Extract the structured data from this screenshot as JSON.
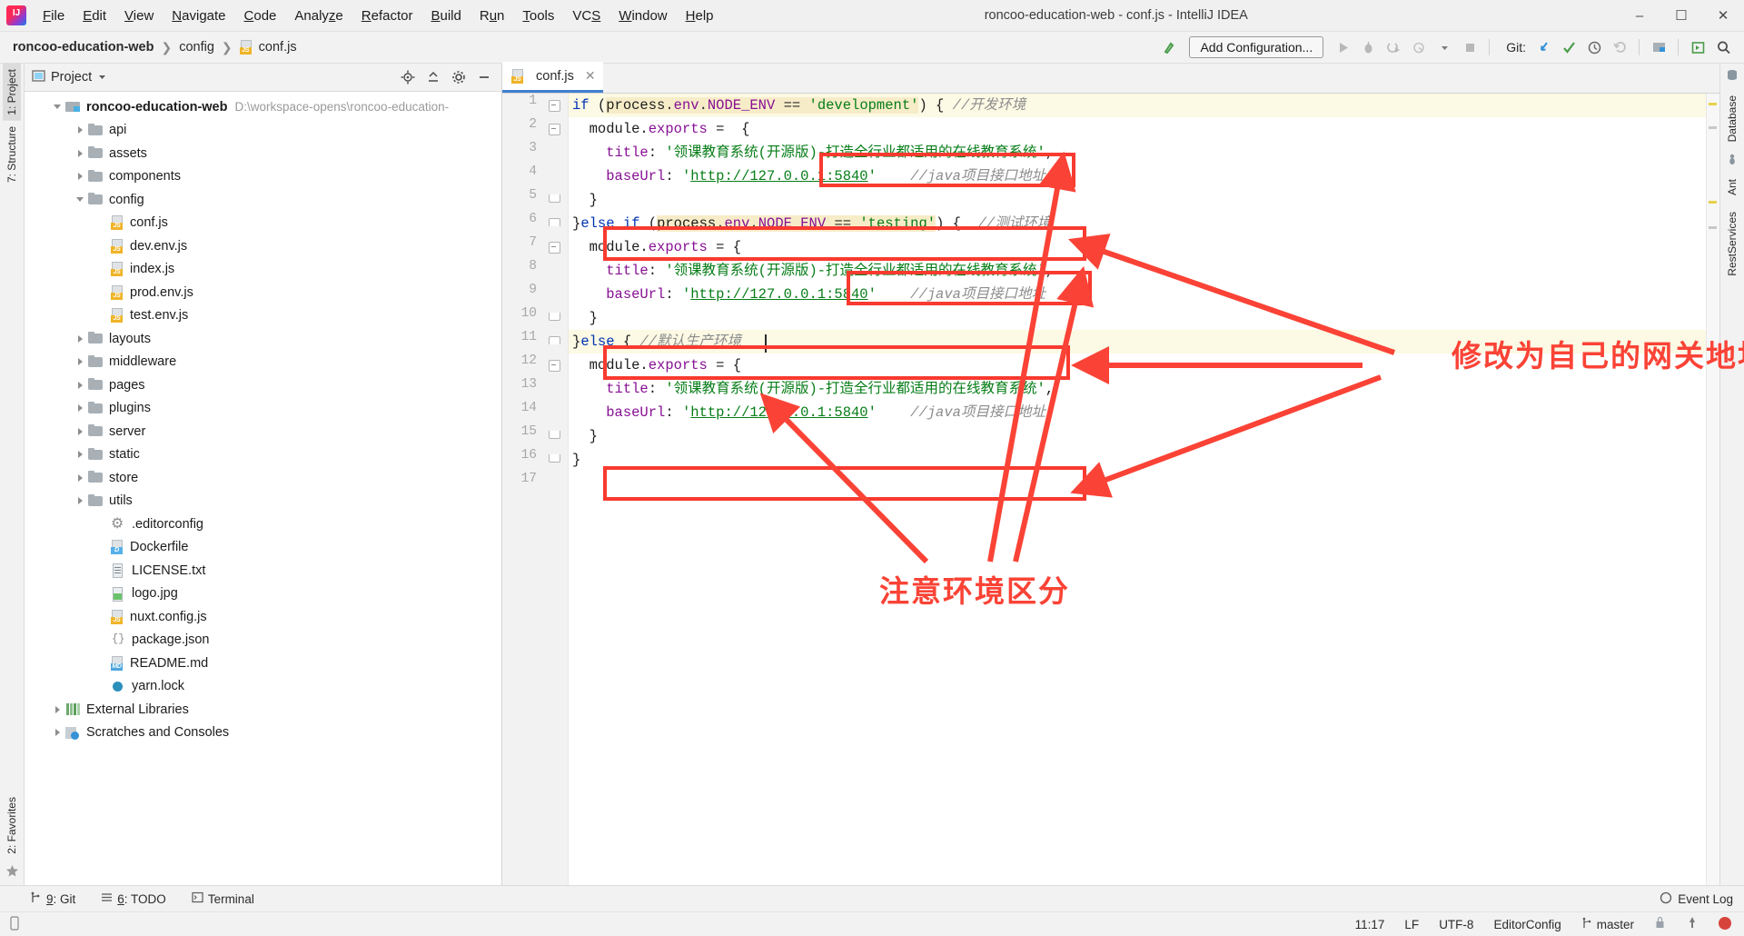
{
  "window": {
    "title": "roncoo-education-web - conf.js - IntelliJ IDEA",
    "logo_icon": "intellij-idea-logo",
    "minimize_icon": "minimize-icon",
    "maximize_icon": "maximize-icon",
    "close_icon": "close-icon"
  },
  "menubar": {
    "items": [
      {
        "label": "File"
      },
      {
        "label": "Edit"
      },
      {
        "label": "View"
      },
      {
        "label": "Navigate"
      },
      {
        "label": "Code"
      },
      {
        "label": "Analyze"
      },
      {
        "label": "Refactor"
      },
      {
        "label": "Build"
      },
      {
        "label": "Run"
      },
      {
        "label": "Tools"
      },
      {
        "label": "VCS"
      },
      {
        "label": "Window"
      },
      {
        "label": "Help"
      }
    ]
  },
  "navbar": {
    "breadcrumb": [
      "roncoo-education-web",
      "config",
      "conf.js"
    ],
    "separator": "›",
    "add_configuration": "Add Configuration...",
    "git_label": "Git:",
    "icons": [
      "build-icon",
      "run-icon",
      "debug-icon",
      "run-with-coverage-icon",
      "profile-icon",
      "dropdown-icon",
      "stop-icon",
      "update-project-icon",
      "commit-icon",
      "history-icon",
      "rollback-icon",
      "project-structure-icon",
      "select-in-icon",
      "search-everywhere-icon"
    ]
  },
  "left_rail": {
    "tabs": [
      "1: Project",
      "7: Structure",
      "2: Favorites"
    ],
    "star_icon": "star-icon"
  },
  "right_rail": {
    "tabs": [
      "Database",
      "Ant",
      "RestServices"
    ]
  },
  "project_panel": {
    "title": "Project",
    "title_icon": "project-view-icon",
    "dropdown_icon": "chevron-down-icon",
    "actions": [
      "locate-icon",
      "collapse-all-icon",
      "settings-gear-icon",
      "hide-icon"
    ],
    "tree": [
      {
        "label": "roncoo-education-web",
        "path": "D:\\workspace-opens\\roncoo-education-",
        "depth": 0,
        "arrow": "open",
        "icon": "module-icon",
        "bold": true
      },
      {
        "label": "api",
        "depth": 1,
        "arrow": "closed",
        "icon": "folder-icon"
      },
      {
        "label": "assets",
        "depth": 1,
        "arrow": "closed",
        "icon": "folder-icon"
      },
      {
        "label": "components",
        "depth": 1,
        "arrow": "closed",
        "icon": "folder-icon"
      },
      {
        "label": "config",
        "depth": 1,
        "arrow": "open",
        "icon": "folder-icon"
      },
      {
        "label": "conf.js",
        "depth": 2,
        "arrow": "none",
        "icon": "js-file-icon",
        "badge": "JS"
      },
      {
        "label": "dev.env.js",
        "depth": 2,
        "arrow": "none",
        "icon": "js-file-icon",
        "badge": "JS"
      },
      {
        "label": "index.js",
        "depth": 2,
        "arrow": "none",
        "icon": "js-file-icon",
        "badge": "JS"
      },
      {
        "label": "prod.env.js",
        "depth": 2,
        "arrow": "none",
        "icon": "js-file-icon",
        "badge": "JS"
      },
      {
        "label": "test.env.js",
        "depth": 2,
        "arrow": "none",
        "icon": "js-file-icon",
        "badge": "JS"
      },
      {
        "label": "layouts",
        "depth": 1,
        "arrow": "closed",
        "icon": "folder-icon"
      },
      {
        "label": "middleware",
        "depth": 1,
        "arrow": "closed",
        "icon": "folder-icon"
      },
      {
        "label": "pages",
        "depth": 1,
        "arrow": "closed",
        "icon": "folder-icon"
      },
      {
        "label": "plugins",
        "depth": 1,
        "arrow": "closed",
        "icon": "folder-icon"
      },
      {
        "label": "server",
        "depth": 1,
        "arrow": "closed",
        "icon": "folder-icon"
      },
      {
        "label": "static",
        "depth": 1,
        "arrow": "closed",
        "icon": "folder-icon"
      },
      {
        "label": "store",
        "depth": 1,
        "arrow": "closed",
        "icon": "folder-icon"
      },
      {
        "label": "utils",
        "depth": 1,
        "arrow": "closed",
        "icon": "folder-icon"
      },
      {
        "label": ".editorconfig",
        "depth": 2,
        "arrow": "none",
        "icon": "gear-file-icon"
      },
      {
        "label": "Dockerfile",
        "depth": 2,
        "arrow": "none",
        "icon": "docker-file-icon",
        "badge": "D"
      },
      {
        "label": "LICENSE.txt",
        "depth": 2,
        "arrow": "none",
        "icon": "text-file-icon"
      },
      {
        "label": "logo.jpg",
        "depth": 2,
        "arrow": "none",
        "icon": "image-file-icon"
      },
      {
        "label": "nuxt.config.js",
        "depth": 2,
        "arrow": "none",
        "icon": "js-file-icon",
        "badge": "JS"
      },
      {
        "label": "package.json",
        "depth": 2,
        "arrow": "none",
        "icon": "json-file-icon"
      },
      {
        "label": "README.md",
        "depth": 2,
        "arrow": "none",
        "icon": "markdown-file-icon",
        "badge": "MD"
      },
      {
        "label": "yarn.lock",
        "depth": 2,
        "arrow": "none",
        "icon": "yarn-file-icon"
      },
      {
        "label": "External Libraries",
        "depth": 0,
        "arrow": "closed",
        "icon": "libraries-icon"
      },
      {
        "label": "Scratches and Consoles",
        "depth": 0,
        "arrow": "closed",
        "icon": "scratches-icon"
      }
    ]
  },
  "editor": {
    "tab": {
      "label": "conf.js",
      "icon": "js-file-icon",
      "close_icon": "close-icon"
    },
    "line_numbers": [
      1,
      2,
      3,
      4,
      5,
      6,
      7,
      8,
      9,
      10,
      11,
      12,
      13,
      14,
      15,
      16,
      17
    ],
    "code_lines": [
      {
        "n": 1,
        "text": "if (process.env.NODE_ENV == 'development') { //开发环境"
      },
      {
        "n": 2,
        "text": "  module.exports =  {"
      },
      {
        "n": 3,
        "text": "    title: '领课教育系统(开源版)-打造全行业都适用的在线教育系统',"
      },
      {
        "n": 4,
        "text": "    baseUrl: 'http://127.0.0.1:5840'    //java项目接口地址"
      },
      {
        "n": 5,
        "text": "  }"
      },
      {
        "n": 6,
        "text": "}else if (process.env.NODE_ENV == 'testing') {  //测试环境"
      },
      {
        "n": 7,
        "text": "  module.exports = {"
      },
      {
        "n": 8,
        "text": "    title: '领课教育系统(开源版)-打造全行业都适用的在线教育系统',"
      },
      {
        "n": 9,
        "text": "    baseUrl: 'http://127.0.0.1:5840'    //java项目接口地址"
      },
      {
        "n": 10,
        "text": "  }"
      },
      {
        "n": 11,
        "text": "}else { //默认生产环境"
      },
      {
        "n": 12,
        "text": "  module.exports = {"
      },
      {
        "n": 13,
        "text": "    title: '领课教育系统(开源版)-打造全行业都适用的在线教育系统',"
      },
      {
        "n": 14,
        "text": "    baseUrl: 'http://127.0.0.1:5840'    //java项目接口地址"
      },
      {
        "n": 15,
        "text": "  }"
      },
      {
        "n": 16,
        "text": "}"
      },
      {
        "n": 17,
        "text": ""
      }
    ]
  },
  "annotations": {
    "gateway_note": "修改为自己的网关地址",
    "env_note": "注意环境区分",
    "color": "#fa4336"
  },
  "bottom_toolbar": {
    "items": [
      {
        "label": "9: Git",
        "icon": "git-icon"
      },
      {
        "label": "6: TODO",
        "icon": "todo-icon"
      },
      {
        "label": "Terminal",
        "icon": "terminal-icon"
      }
    ],
    "event_log": "Event Log",
    "event_log_icon": "event-log-icon"
  },
  "statusbar": {
    "left_icon": "memory-indicator-icon",
    "caret": "11:17",
    "line_separator": "LF",
    "encoding": "UTF-8",
    "editorconfig": "EditorConfig",
    "branch": "master",
    "branch_icon": "git-branch-icon",
    "lock_icon": "read-only-lock-icon",
    "inspection_icon": "inspections-icon",
    "notification_icon": "notification-error-icon"
  }
}
